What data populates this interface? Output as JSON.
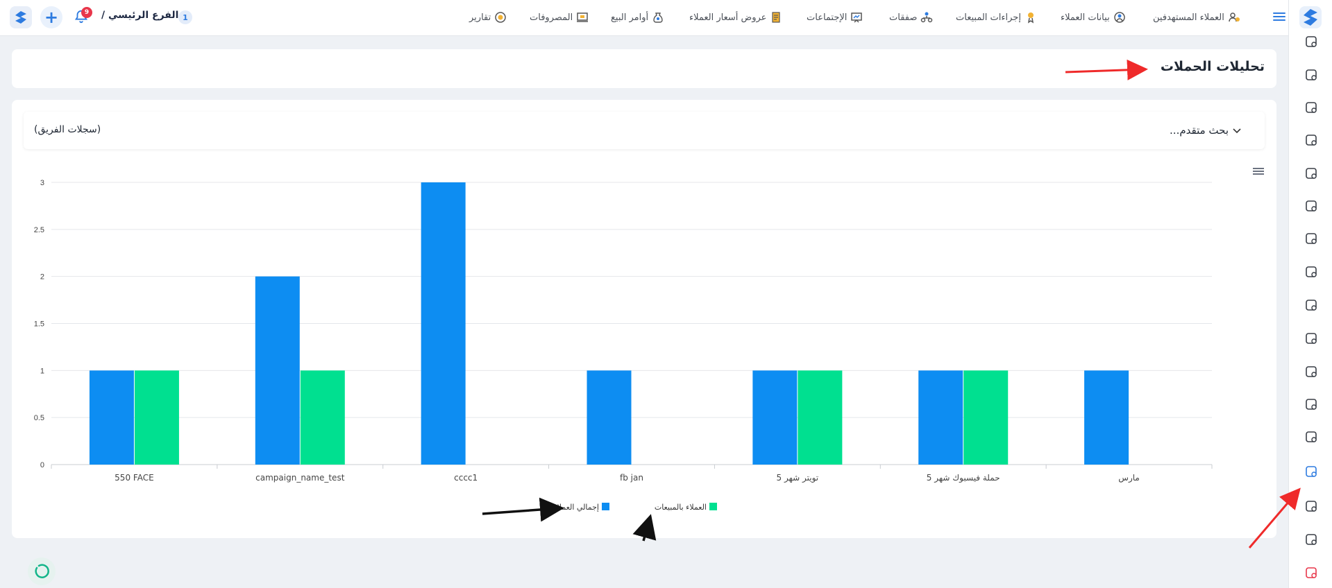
{
  "branch": {
    "label": "الفرع الرئيسي /",
    "count": "1"
  },
  "notifications": {
    "count": "9"
  },
  "nav": [
    {
      "label": "العملاء المستهدفين",
      "icon": "target-users-icon"
    },
    {
      "label": "بيانات العملاء",
      "icon": "client-data-icon"
    },
    {
      "label": "إجراءات المبيعات",
      "icon": "sales-actions-icon"
    },
    {
      "label": "صفقات",
      "icon": "deals-icon"
    },
    {
      "label": "الإجتماعات",
      "icon": "meetings-icon"
    },
    {
      "label": "عروض أسعار العملاء",
      "icon": "quotes-icon"
    },
    {
      "label": "أوامر البيع",
      "icon": "sales-orders-icon"
    },
    {
      "label": "المصروفات",
      "icon": "expenses-icon"
    },
    {
      "label": "تقارير",
      "icon": "reports-icon"
    }
  ],
  "page": {
    "title": "تحليلات الحملات",
    "advanced_search": "بحث متقدم...",
    "team_records": "(سجلات الفريق)"
  },
  "colors": {
    "primary": "#2d7be0",
    "series_total": "#0d8df2",
    "series_sales": "#00e090",
    "annotation_red": "#ef2a2a"
  },
  "sidebar_icons": [
    "folder-add-icon",
    "team-icon",
    "money-icon",
    "warning-icon",
    "video-call-icon",
    "mountain-icon",
    "invoice-icon",
    "pen-icon",
    "report-doc-icon",
    "shipping-icon",
    "user-phone-icon",
    "doc-add-icon",
    "doc-check-icon",
    "analytics-icon",
    "settings-icon",
    "window-icon",
    "power-icon"
  ],
  "chart_data": {
    "type": "bar",
    "categories": [
      "550 FACE",
      "campaign_name_test",
      "cccc1",
      "fb jan",
      "تويتر شهر 5",
      "حملة فيسبوك شهر 5",
      "مارس"
    ],
    "series": [
      {
        "name": "إجمالي العملاء",
        "color": "#0d8df2",
        "values": [
          1,
          2,
          3,
          1,
          1,
          1,
          1
        ]
      },
      {
        "name": "العملاء بالمبيعات",
        "color": "#00e090",
        "values": [
          1,
          1,
          0,
          0,
          1,
          1,
          0
        ]
      }
    ],
    "ylim": [
      0,
      3
    ],
    "yticks": [
      "0",
      "0.5",
      "1",
      "1.5",
      "2",
      "2.5",
      "3"
    ],
    "grid": true,
    "legend": "bottom-center"
  }
}
